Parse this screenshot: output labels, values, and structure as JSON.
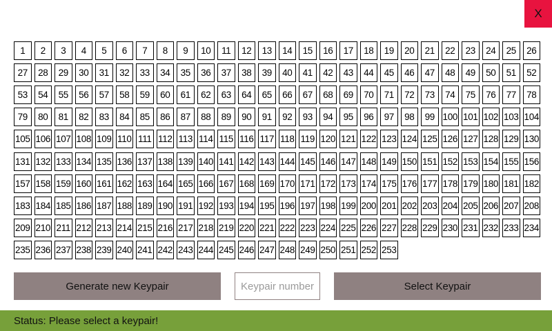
{
  "close_button": {
    "label": "X",
    "color": "#e8133f"
  },
  "keypairs": {
    "first": 1,
    "count": 253,
    "columns": 26
  },
  "actions": {
    "generate_label": "Generate new Keypair",
    "select_label": "Select Keypair",
    "button_color": "#8f8181"
  },
  "keypair_input": {
    "value": "",
    "placeholder": "Keypair number"
  },
  "status": {
    "text": "Status: Please select a keypair!",
    "color": "#77a03a"
  }
}
